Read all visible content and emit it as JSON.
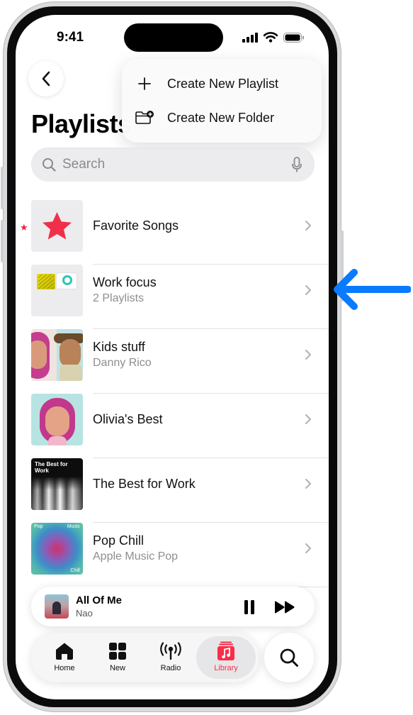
{
  "status_bar": {
    "time": "9:41"
  },
  "header": {
    "title": "Playlists"
  },
  "menu": {
    "items": [
      {
        "label": "Create New Playlist",
        "icon": "plus-icon"
      },
      {
        "label": "Create New Folder",
        "icon": "folder-plus-icon"
      }
    ]
  },
  "search": {
    "placeholder": "Search"
  },
  "playlists": [
    {
      "name": "Favorite Songs",
      "subtitle": ""
    },
    {
      "name": "Work focus",
      "subtitle": "2 Playlists"
    },
    {
      "name": "Kids stuff",
      "subtitle": "Danny Rico"
    },
    {
      "name": "Olivia's Best",
      "subtitle": ""
    },
    {
      "name": "The Best for Work",
      "subtitle": ""
    },
    {
      "name": "Pop Chill",
      "subtitle": "Apple Music Pop"
    }
  ],
  "artwork_text": {
    "best_for_work": "The Best for Work",
    "pop": "Pop",
    "apple_music": "Music",
    "chill": "Chill"
  },
  "now_playing": {
    "title": "All Of Me",
    "artist": "Nao"
  },
  "tabs": [
    {
      "label": "Home",
      "icon": "home-icon"
    },
    {
      "label": "New",
      "icon": "grid-icon"
    },
    {
      "label": "Radio",
      "icon": "radio-icon"
    },
    {
      "label": "Library",
      "icon": "library-icon",
      "active": true
    }
  ],
  "colors": {
    "accent": "#fa2d48",
    "callout_arrow": "#0a7aff",
    "favorite_star": "#e8243f"
  }
}
